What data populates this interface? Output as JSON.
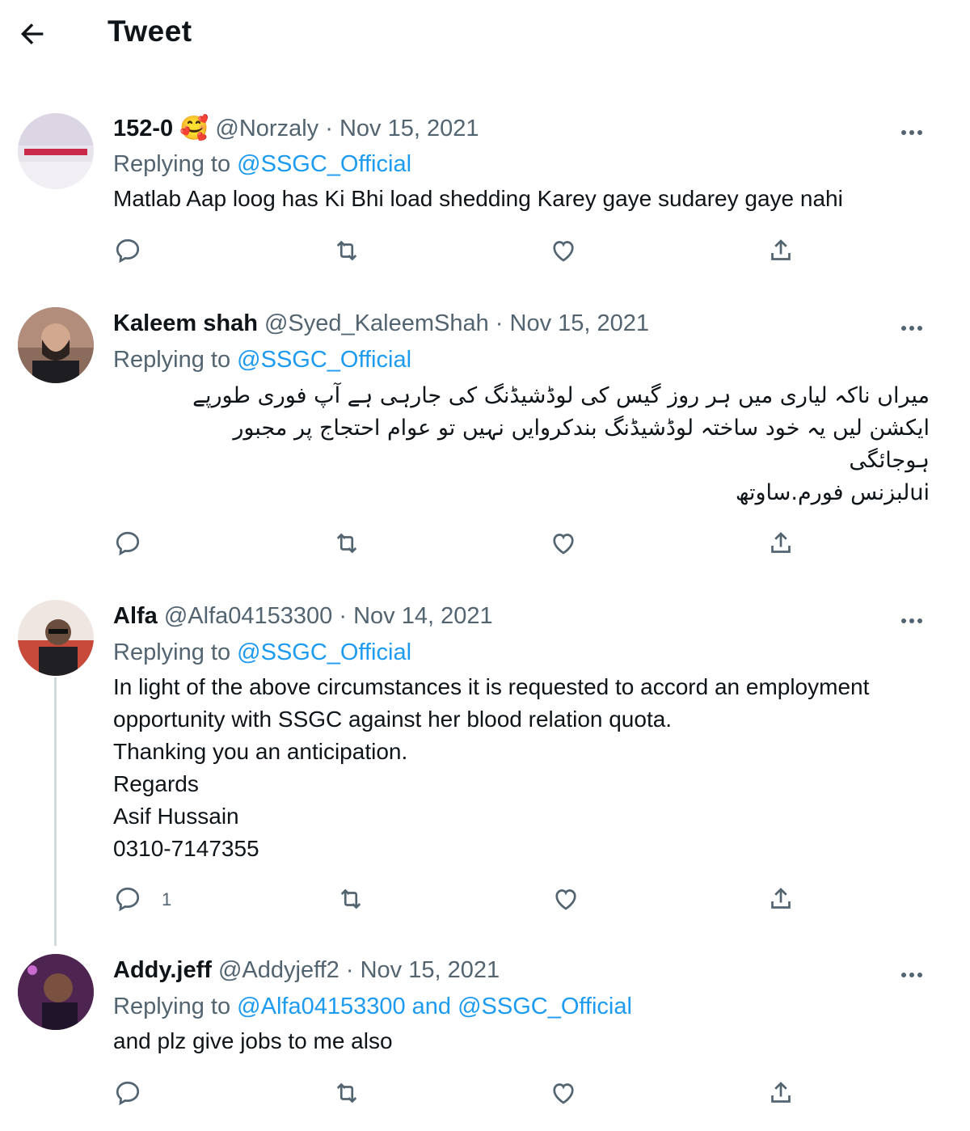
{
  "header": {
    "title": "Tweet",
    "back_icon": "back-arrow-icon"
  },
  "colors": {
    "link": "#1d9bf0",
    "muted": "#536471",
    "text": "#0f1419",
    "thread_line": "#cfd9de"
  },
  "tweets": [
    {
      "name": "152-0",
      "emoji": "🥰",
      "handle": "@Norzaly",
      "sep": "·",
      "date": "Nov 15, 2021",
      "replying_prefix": "Replying to",
      "replying_to": "@SSGC_Official",
      "text": "Matlab Aap loog has Ki Bhi load shedding Karey gaye sudarey gaye nahi",
      "reply_count": ""
    },
    {
      "name": "Kaleem shah",
      "handle": "@Syed_KaleemShah",
      "sep": "·",
      "date": "Nov 15, 2021",
      "replying_prefix": "Replying to",
      "replying_to": "@SSGC_Official",
      "text_lines": [
        "میراں ناکہ لیاری میں ہر روز گیس کی لوڈشیڈنگ کی جارہی ہے آپ فوری طورپے",
        "ایکشن لیں یہ خود ساختہ لوڈشیڈنگ بندکروایں نہیں تو عوام احتجاج پر مجبور",
        "ہوجائگی",
        "uiلبزنس فورم.ساوتھ"
      ],
      "reply_count": ""
    },
    {
      "name": "Alfa",
      "handle": "@Alfa04153300",
      "sep": "·",
      "date": "Nov 14, 2021",
      "replying_prefix": "Replying to",
      "replying_to": "@SSGC_Official",
      "text_lines": [
        "In light of the above circumstances it is requested to accord an employment",
        "opportunity with SSGC against her blood relation quota.",
        "Thanking you an anticipation.",
        "Regards",
        "Asif Hussain",
        "0310-7147355"
      ],
      "reply_count": "1"
    },
    {
      "name": "Addy.jeff",
      "handle": "@Addyjeff2",
      "sep": "·",
      "date": "Nov 15, 2021",
      "replying_prefix": "Replying to",
      "replying_to": "@Alfa04153300 and @SSGC_Official",
      "text": "and plz give jobs to me also",
      "reply_count": ""
    }
  ],
  "icons": {
    "reply": "reply-icon",
    "retweet": "retweet-icon",
    "like": "like-icon",
    "share": "share-icon",
    "more": "more-icon"
  }
}
